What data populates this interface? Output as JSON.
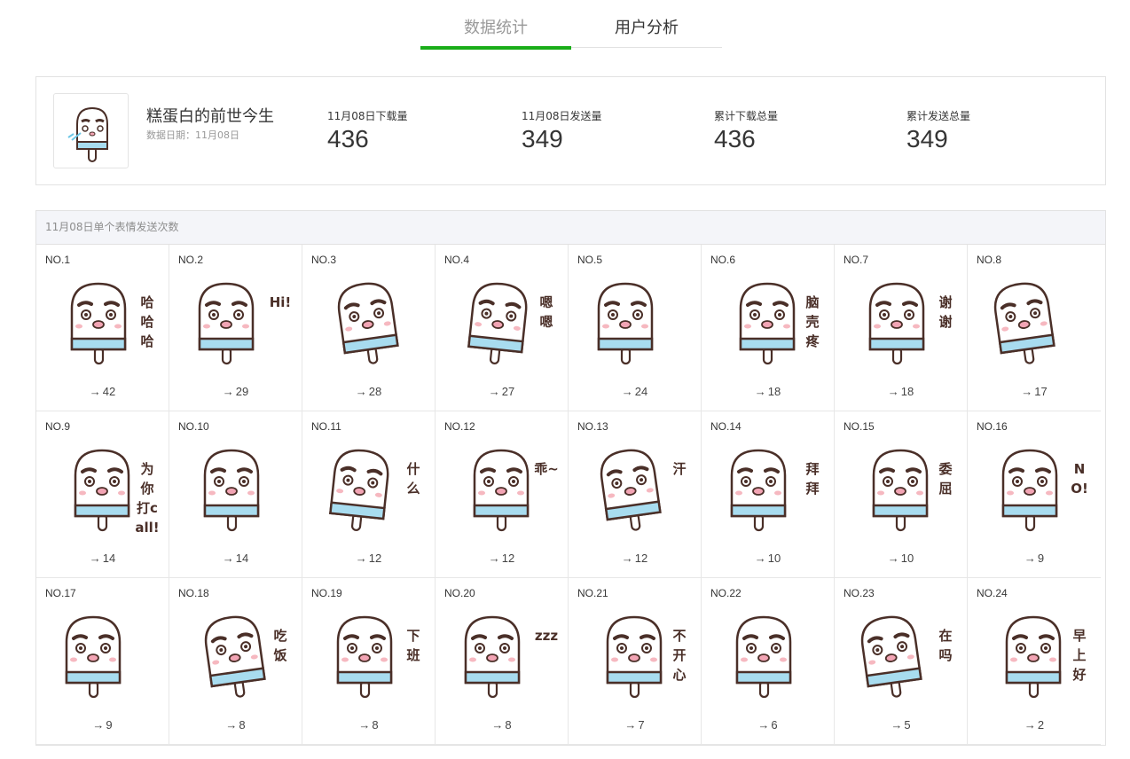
{
  "tabs": [
    {
      "label": "数据统计",
      "active": true
    },
    {
      "label": "用户分析",
      "active": false
    }
  ],
  "summary": {
    "pack_name": "糕蛋白的前世今生",
    "date_label": "数据日期：11月08日",
    "stats": [
      {
        "label": "11月08日下载量",
        "value": "436"
      },
      {
        "label": "11月08日发送量",
        "value": "349"
      },
      {
        "label": "累计下载总量",
        "value": "436"
      },
      {
        "label": "累计发送总量",
        "value": "349"
      }
    ]
  },
  "panel": {
    "title": "11月08日单个表情发送次数",
    "arrow_glyph": "→",
    "items": [
      {
        "no": "NO.1",
        "count": "42",
        "caption": "哈哈哈"
      },
      {
        "no": "NO.2",
        "count": "29",
        "caption": "Hi!"
      },
      {
        "no": "NO.3",
        "count": "28",
        "caption": ""
      },
      {
        "no": "NO.4",
        "count": "27",
        "caption": "嗯嗯"
      },
      {
        "no": "NO.5",
        "count": "24",
        "caption": ""
      },
      {
        "no": "NO.6",
        "count": "18",
        "caption": "脑壳疼"
      },
      {
        "no": "NO.7",
        "count": "18",
        "caption": "谢谢"
      },
      {
        "no": "NO.8",
        "count": "17",
        "caption": ""
      },
      {
        "no": "NO.9",
        "count": "14",
        "caption": "为你打call!"
      },
      {
        "no": "NO.10",
        "count": "14",
        "caption": ""
      },
      {
        "no": "NO.11",
        "count": "12",
        "caption": "什么"
      },
      {
        "no": "NO.12",
        "count": "12",
        "caption": "乖~"
      },
      {
        "no": "NO.13",
        "count": "12",
        "caption": "汗"
      },
      {
        "no": "NO.14",
        "count": "10",
        "caption": "拜拜"
      },
      {
        "no": "NO.15",
        "count": "10",
        "caption": "委屈"
      },
      {
        "no": "NO.16",
        "count": "9",
        "caption": "NO!"
      },
      {
        "no": "NO.17",
        "count": "9",
        "caption": ""
      },
      {
        "no": "NO.18",
        "count": "8",
        "caption": "吃饭"
      },
      {
        "no": "NO.19",
        "count": "8",
        "caption": "下班"
      },
      {
        "no": "NO.20",
        "count": "8",
        "caption": "zzz"
      },
      {
        "no": "NO.21",
        "count": "7",
        "caption": "不开心"
      },
      {
        "no": "NO.22",
        "count": "6",
        "caption": ""
      },
      {
        "no": "NO.23",
        "count": "5",
        "caption": "在吗"
      },
      {
        "no": "NO.24",
        "count": "2",
        "caption": "早上好"
      }
    ]
  },
  "colors": {
    "accent": "#1aad19",
    "sticker_body": "#ffffff",
    "sticker_outline": "#4a2f28",
    "sticker_band": "#a8dcef",
    "cheek": "#f6b8c0",
    "nose": "#f2a4b4"
  }
}
